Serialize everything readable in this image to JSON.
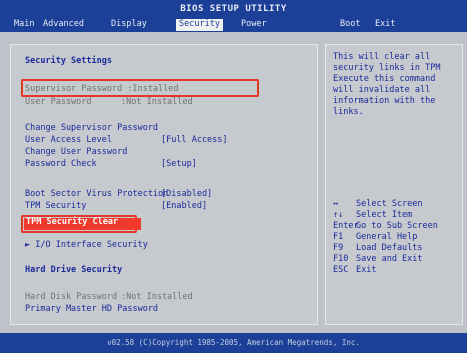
{
  "title": "BIOS SETUP UTILITY",
  "menu": [
    "Main",
    "Advanced",
    "Display",
    "Security",
    "Power",
    "Boot",
    "Exit"
  ],
  "main": {
    "section_title": "Security Settings",
    "supervisor_password": "Supervisor Password :Installed",
    "user_password_label": "User Password",
    "user_password_value": ":Not Installed",
    "change_supervisor": "Change Supervisor Password",
    "user_access_label": "User Access Level",
    "user_access_value": "[Full Access]",
    "change_user": "Change User Password",
    "password_check_label": "Password Check",
    "password_check_value": "[Setup]",
    "boot_virus_label": "Boot Sector Virus Protection",
    "boot_virus_value": "[Disabled]",
    "tpm_security_label": "TPM Security",
    "tpm_security_value": "[Enabled]",
    "tpm_clear": "TPM Security Clear",
    "io_interface": "► I/O Interface Security",
    "hdd_title": "Hard Drive Security",
    "hdd_password_label": "Hard Disk Password",
    "hdd_password_value": ":Not Installed",
    "primary_master": "Primary Master HD Password"
  },
  "help": {
    "lines": [
      "This will clear all",
      "security links in TPM",
      "Execute this command",
      "will invalidate all",
      "information with the",
      "links."
    ],
    "keys": [
      {
        "key": "↔",
        "desc": "Select Screen"
      },
      {
        "key": "↑↓",
        "desc": "Select Item"
      },
      {
        "key": "Enter",
        "desc": "Go to Sub Screen"
      },
      {
        "key": "F1",
        "desc": "General Help"
      },
      {
        "key": "F9",
        "desc": "Load Defaults"
      },
      {
        "key": "F10",
        "desc": "Save and Exit"
      },
      {
        "key": "ESC",
        "desc": "Exit"
      }
    ]
  },
  "footer": "v02.58 (C)Copyright 1985-2005, American Megatrends, Inc.",
  "colors": {
    "header_blue": "#1c3f98",
    "panel_gray": "#c6c9ce",
    "text_blue": "#1a2a9a",
    "highlight_red": "#ef3a2c"
  }
}
